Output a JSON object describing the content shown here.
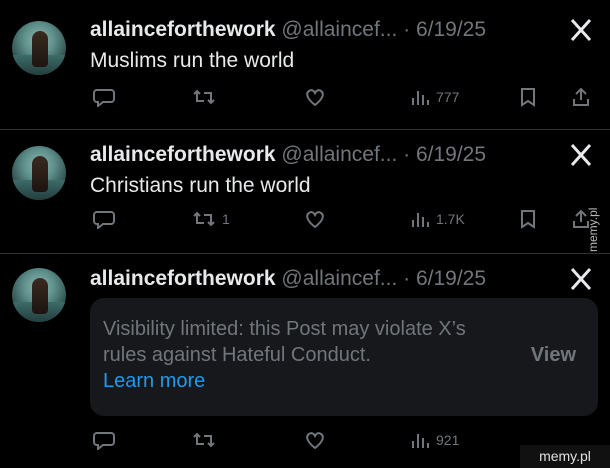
{
  "posts": [
    {
      "display_name": "allainceforthework",
      "handle": "@allaincef...",
      "date": "6/19/25",
      "text": "Muslims run the world",
      "reposts": "",
      "views": "777"
    },
    {
      "display_name": "allainceforthework",
      "handle": "@allaincef...",
      "date": "6/19/25",
      "text": "Christians run the world",
      "reposts": "1",
      "views": "1.7K"
    },
    {
      "display_name": "allainceforthework",
      "handle": "@allaincef...",
      "date": "6/19/25",
      "notice_text": "Visibility limited: this Post may violate X’s rules against Hateful Conduct.",
      "learn_more": "Learn more",
      "view_label": "View",
      "views": "921"
    }
  ],
  "watermarks": {
    "side": "memy.pl",
    "bottom": "memy.pl"
  },
  "icons": [
    "x-logo-icon",
    "reply-icon",
    "repost-icon",
    "like-icon",
    "views-icon",
    "bookmark-icon",
    "share-icon"
  ]
}
